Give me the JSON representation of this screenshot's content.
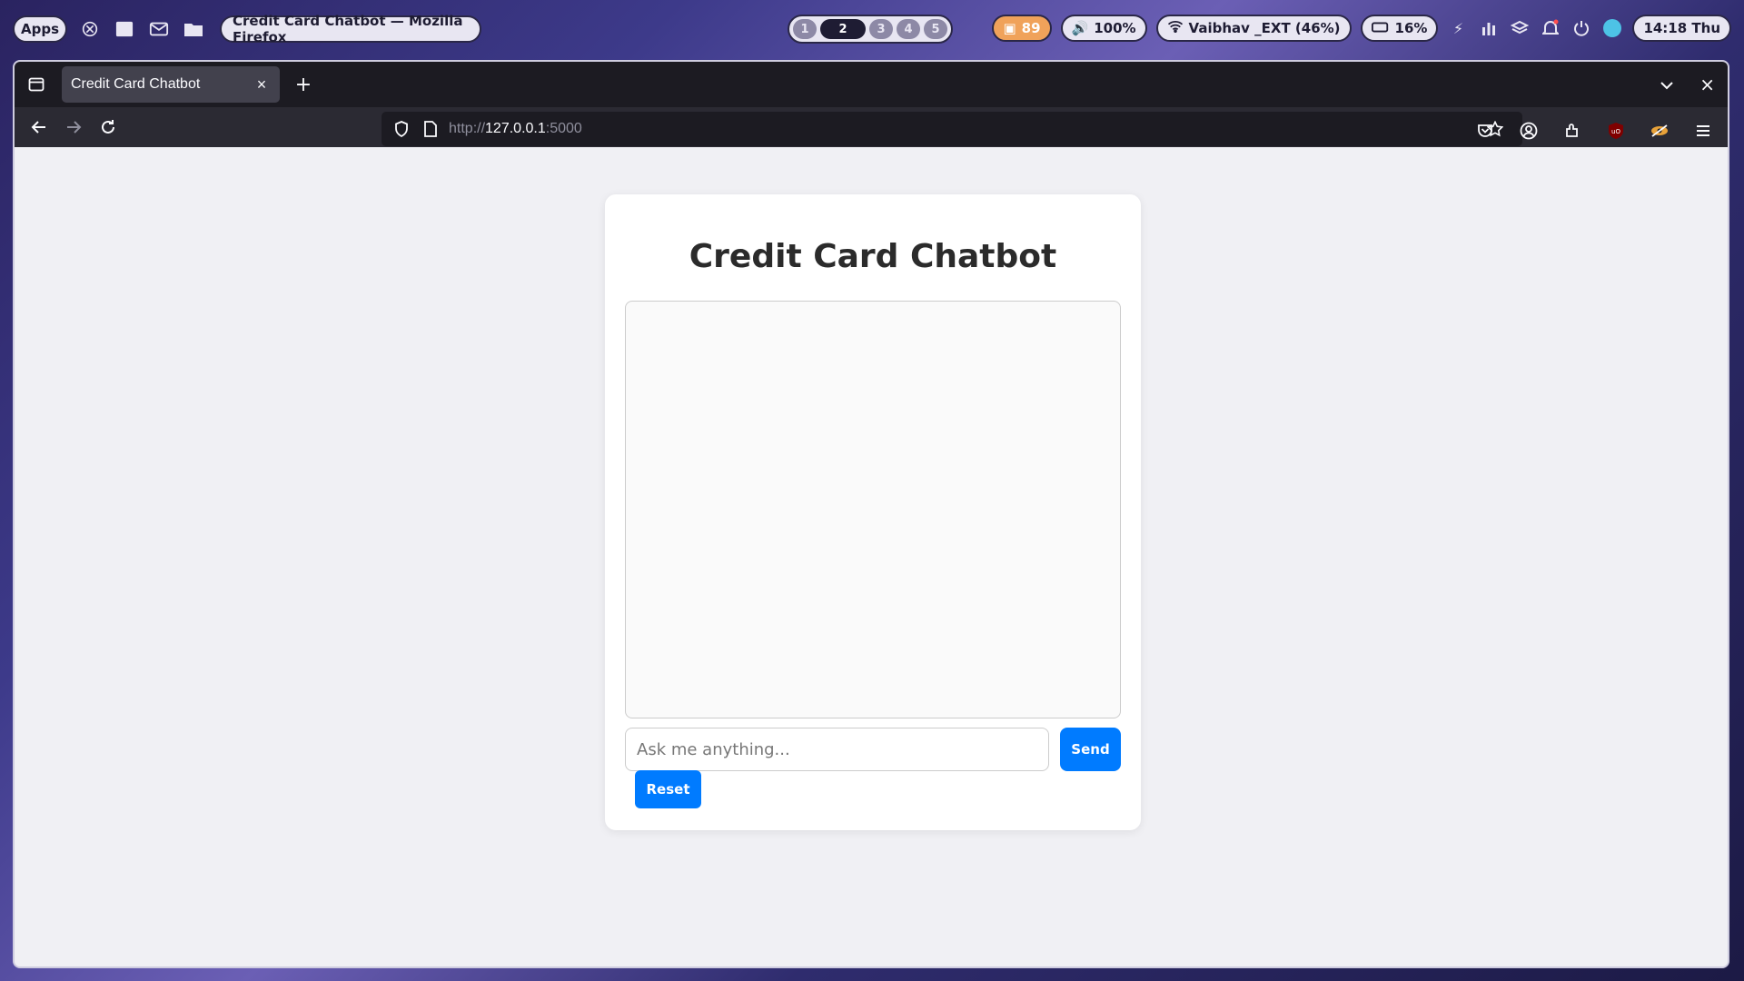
{
  "panel": {
    "apps_label": "Apps",
    "window_title": "Credit Card Chatbot — Mozilla Firefox",
    "workspaces": [
      "1",
      "2",
      "3",
      "4",
      "5"
    ],
    "active_workspace": "2",
    "updates_count": "89",
    "volume": "100%",
    "wifi": "Vaibhav _EXT (46%)",
    "battery": "16%",
    "clock": "14:18 Thu"
  },
  "browser": {
    "tab_title": "Credit Card Chatbot",
    "url_prefix": "http://",
    "url_host": "127.0.0.1",
    "url_port": ":5000"
  },
  "page": {
    "title": "Credit Card Chatbot",
    "input_placeholder": "Ask me anything...",
    "send_label": "Send",
    "reset_label": "Reset"
  },
  "colors": {
    "accent": "#007bff",
    "card": "#ffffff",
    "page_bg": "#f0f0f4"
  }
}
